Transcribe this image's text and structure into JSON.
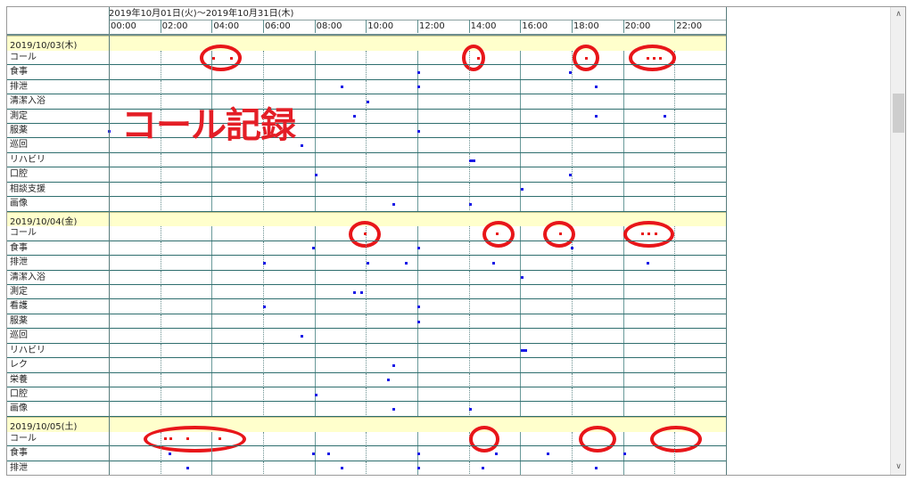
{
  "header": {
    "period": "2019年10月01日(火)～2019年10月31日(木)",
    "times": [
      "00:00",
      "02:00",
      "04:00",
      "06:00",
      "08:00",
      "10:00",
      "12:00",
      "14:00",
      "16:00",
      "18:00",
      "20:00",
      "22:00"
    ]
  },
  "annotation": "コール記録",
  "days": [
    {
      "date": "2019/10/03(木)",
      "rows": [
        {
          "label": "コール",
          "events": [
            {
              "t": 4.05,
              "c": "#e81a1a"
            },
            {
              "t": 4.75,
              "c": "#e81a1a"
            },
            {
              "t": 14.35,
              "c": "#e81a1a"
            },
            {
              "t": 18.55,
              "c": "#e81a1a"
            },
            {
              "t": 20.95,
              "c": "#e81a1a"
            },
            {
              "t": 21.2,
              "c": "#e81a1a"
            },
            {
              "t": 21.45,
              "c": "#e81a1a"
            }
          ],
          "rings": [
            [
              4.35,
              1.65
            ],
            [
              14.2,
              0.9
            ],
            [
              18.55,
              1.05
            ],
            [
              21.15,
              1.85
            ]
          ]
        },
        {
          "label": "食事",
          "events": [
            {
              "t": 12.05
            },
            {
              "t": 17.95
            }
          ]
        },
        {
          "label": "排泄",
          "events": [
            {
              "t": 9.05
            },
            {
              "t": 12.05
            },
            {
              "t": 18.95
            }
          ]
        },
        {
          "label": "清潔入浴",
          "events": [
            {
              "t": 10.05
            }
          ]
        },
        {
          "label": "測定",
          "events": [
            {
              "t": 9.55
            },
            {
              "t": 18.95
            },
            {
              "t": 21.6
            }
          ]
        },
        {
          "label": "服薬",
          "events": [
            {
              "t": 0.0
            },
            {
              "t": 12.05
            }
          ]
        },
        {
          "label": "巡回",
          "events": [
            {
              "t": 7.5
            }
          ]
        },
        {
          "label": "リハビリ",
          "events": [
            {
              "t": 14.05,
              "w": 0.25
            }
          ]
        },
        {
          "label": "口腔",
          "events": [
            {
              "t": 8.05
            },
            {
              "t": 17.95
            }
          ]
        },
        {
          "label": "相談支援",
          "events": [
            {
              "t": 16.05
            }
          ]
        },
        {
          "label": "画像",
          "events": [
            {
              "t": 11.05
            },
            {
              "t": 14.05
            }
          ]
        }
      ]
    },
    {
      "date": "2019/10/04(金)",
      "rows": [
        {
          "label": "コール",
          "events": [
            {
              "t": 9.95,
              "c": "#e81a1a"
            },
            {
              "t": 15.1,
              "c": "#e81a1a"
            },
            {
              "t": 17.55,
              "c": "#e81a1a"
            },
            {
              "t": 20.75,
              "c": "#e81a1a"
            },
            {
              "t": 21.0,
              "c": "#e81a1a"
            },
            {
              "t": 21.25,
              "c": "#e81a1a"
            }
          ],
          "rings": [
            [
              9.95,
              1.25
            ],
            [
              15.15,
              1.25
            ],
            [
              17.5,
              1.25
            ],
            [
              21.0,
              1.95
            ]
          ]
        },
        {
          "label": "食事",
          "events": [
            {
              "t": 7.95
            },
            {
              "t": 12.05
            },
            {
              "t": 18.0
            }
          ]
        },
        {
          "label": "排泄",
          "events": [
            {
              "t": 6.05
            },
            {
              "t": 10.05
            },
            {
              "t": 11.55
            },
            {
              "t": 14.95
            },
            {
              "t": 20.95
            }
          ]
        },
        {
          "label": "清潔入浴",
          "events": [
            {
              "t": 16.05
            }
          ]
        },
        {
          "label": "測定",
          "events": [
            {
              "t": 9.55
            },
            {
              "t": 9.8
            }
          ]
        },
        {
          "label": "看護",
          "events": [
            {
              "t": 6.05
            },
            {
              "t": 12.05
            }
          ]
        },
        {
          "label": "服薬",
          "events": [
            {
              "t": 12.05
            }
          ]
        },
        {
          "label": "巡回",
          "events": [
            {
              "t": 7.5
            }
          ]
        },
        {
          "label": "リハビリ",
          "events": [
            {
              "t": 16.05,
              "w": 0.25
            }
          ]
        },
        {
          "label": "レク",
          "events": [
            {
              "t": 11.05
            }
          ]
        },
        {
          "label": "栄養",
          "events": [
            {
              "t": 10.85
            }
          ]
        },
        {
          "label": "口腔",
          "events": [
            {
              "t": 8.05
            }
          ]
        },
        {
          "label": "画像",
          "events": [
            {
              "t": 11.05
            },
            {
              "t": 14.05
            }
          ]
        }
      ]
    },
    {
      "date": "2019/10/05(土)",
      "rows": [
        {
          "label": "コール",
          "events": [
            {
              "t": 2.2,
              "c": "#e81a1a"
            },
            {
              "t": 2.4,
              "c": "#e81a1a"
            },
            {
              "t": 3.05,
              "c": "#e81a1a"
            },
            {
              "t": 4.3,
              "c": "#e81a1a"
            }
          ],
          "rings": [
            [
              3.35,
              4.0
            ],
            [
              14.6,
              1.2
            ],
            [
              19.0,
              1.45
            ],
            [
              22.05,
              2.0
            ]
          ]
        },
        {
          "label": "食事",
          "events": [
            {
              "t": 2.35
            },
            {
              "t": 7.95
            },
            {
              "t": 8.55
            },
            {
              "t": 12.05
            },
            {
              "t": 15.05
            },
            {
              "t": 17.05
            },
            {
              "t": 20.05
            }
          ]
        },
        {
          "label": "排泄",
          "events": [
            {
              "t": 3.05
            },
            {
              "t": 9.05
            },
            {
              "t": 12.05
            },
            {
              "t": 14.55
            },
            {
              "t": 18.95
            }
          ]
        }
      ]
    }
  ]
}
